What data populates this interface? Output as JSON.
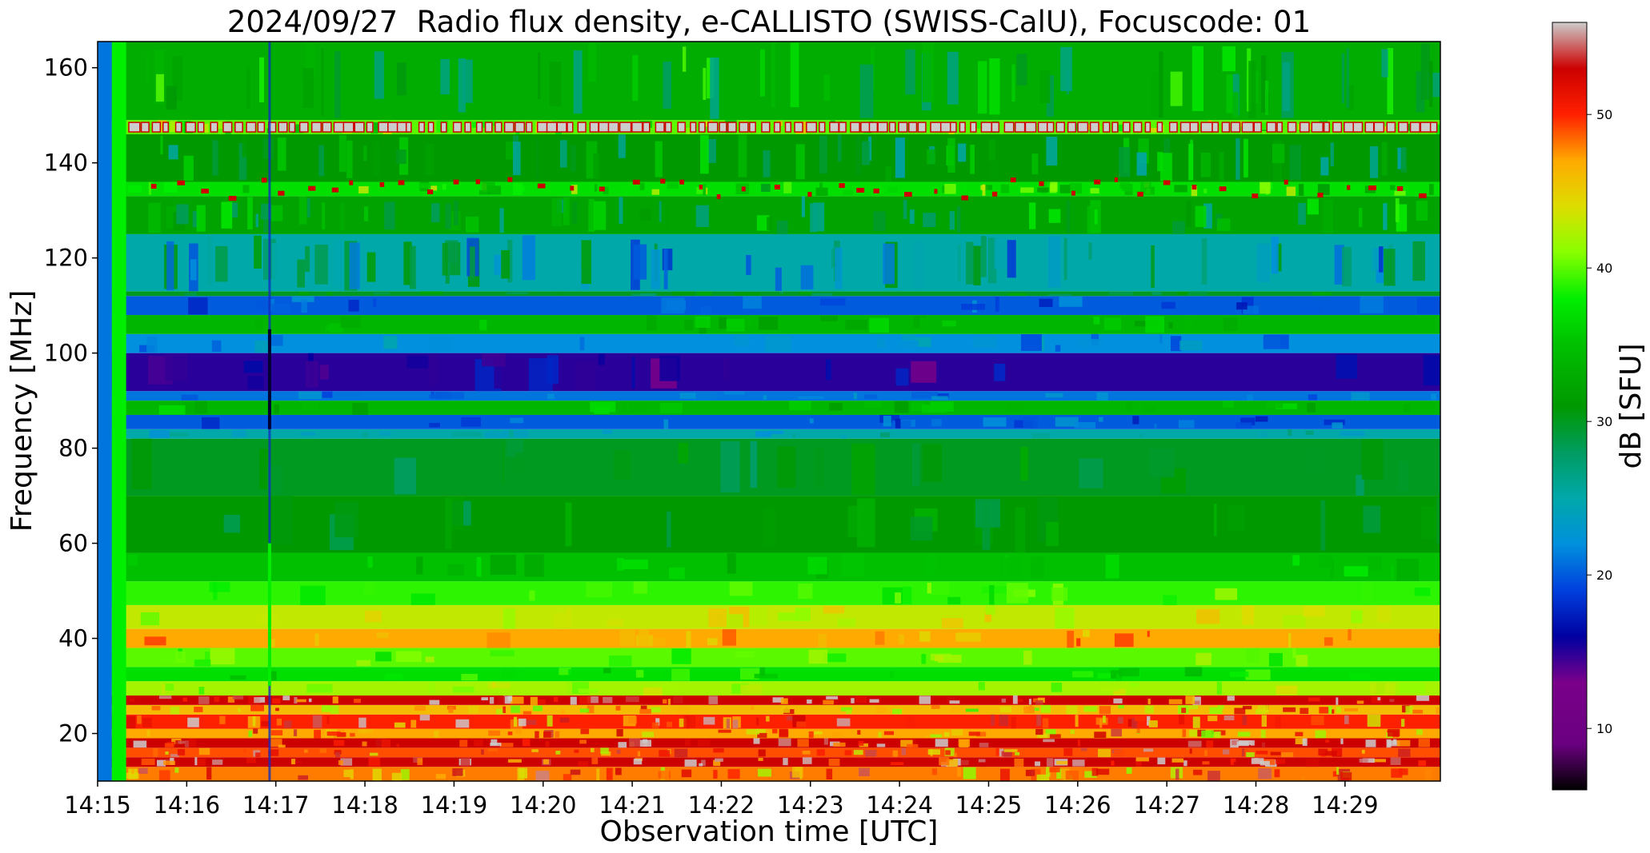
{
  "chart_data": {
    "type": "heatmap",
    "title": "2024/09/27  Radio flux density, e-CALLISTO (SWISS-CalU), Focuscode: 01",
    "xlabel": "Observation time [UTC]",
    "ylabel": "Frequency [MHz]",
    "colorbar_label": "dB [SFU]",
    "x_ticks": [
      "14:15",
      "14:16",
      "14:17",
      "14:18",
      "14:19",
      "14:20",
      "14:21",
      "14:22",
      "14:23",
      "14:24",
      "14:25",
      "14:26",
      "14:27",
      "14:28",
      "14:29"
    ],
    "x_range_minutes": [
      0,
      15.07
    ],
    "y_ticks": [
      20,
      40,
      60,
      80,
      100,
      120,
      140,
      160
    ],
    "ylim": [
      10,
      165.5
    ],
    "colorbar_ticks": [
      10,
      20,
      30,
      40,
      50
    ],
    "colorbar_range": [
      6,
      56
    ],
    "colormap": "nipy_spectral",
    "calibration_segment_minutes": [
      0,
      0.32
    ],
    "burst_time_minutes": 1.93,
    "frequency_bands": [
      {
        "fmin": 10,
        "fmax": 13,
        "db": 48
      },
      {
        "fmin": 13,
        "fmax": 15,
        "db": 53
      },
      {
        "fmin": 15,
        "fmax": 17,
        "db": 49
      },
      {
        "fmin": 17,
        "fmax": 19,
        "db": 53
      },
      {
        "fmin": 19,
        "fmax": 21,
        "db": 47
      },
      {
        "fmin": 21,
        "fmax": 24,
        "db": 50
      },
      {
        "fmin": 24,
        "fmax": 26,
        "db": 46
      },
      {
        "fmin": 26,
        "fmax": 28,
        "db": 53
      },
      {
        "fmin": 28,
        "fmax": 31,
        "db": 42
      },
      {
        "fmin": 31,
        "fmax": 34,
        "db": 37
      },
      {
        "fmin": 34,
        "fmax": 38,
        "db": 40
      },
      {
        "fmin": 38,
        "fmax": 42,
        "db": 47
      },
      {
        "fmin": 42,
        "fmax": 47,
        "db": 43
      },
      {
        "fmin": 47,
        "fmax": 52,
        "db": 39
      },
      {
        "fmin": 52,
        "fmax": 58,
        "db": 35
      },
      {
        "fmin": 58,
        "fmax": 70,
        "db": 31
      },
      {
        "fmin": 70,
        "fmax": 82,
        "db": 30
      },
      {
        "fmin": 82,
        "fmax": 84,
        "db": 25
      },
      {
        "fmin": 84,
        "fmax": 87,
        "db": 20
      },
      {
        "fmin": 87,
        "fmax": 90,
        "db": 34
      },
      {
        "fmin": 90,
        "fmax": 92,
        "db": 21
      },
      {
        "fmin": 92,
        "fmax": 100,
        "db": 15
      },
      {
        "fmin": 100,
        "fmax": 104,
        "db": 22
      },
      {
        "fmin": 104,
        "fmax": 108,
        "db": 34
      },
      {
        "fmin": 108,
        "fmax": 112,
        "db": 20
      },
      {
        "fmin": 112,
        "fmax": 113,
        "db": 30
      },
      {
        "fmin": 113,
        "fmax": 125,
        "db": 25
      },
      {
        "fmin": 125,
        "fmax": 133,
        "db": 32
      },
      {
        "fmin": 133,
        "fmax": 136,
        "db": 37
      },
      {
        "fmin": 136,
        "fmax": 146,
        "db": 31
      },
      {
        "fmin": 146,
        "fmax": 149,
        "db": 40
      },
      {
        "fmin": 149,
        "fmax": 165.5,
        "db": 33
      }
    ]
  }
}
